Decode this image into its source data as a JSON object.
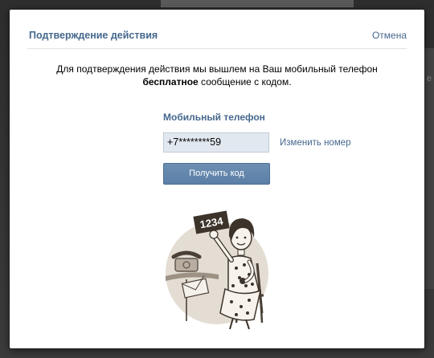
{
  "dialog": {
    "title": "Подтверждение действия",
    "cancel_label": "Отмена",
    "message_line1": "Для подтверждения действия мы вышлем на Ваш мобильный телефон",
    "message_bold": "бесплатное",
    "message_rest": " сообщение с кодом.",
    "phone_label": "Мобильный телефон",
    "phone_value": "+7********59",
    "change_number_label": "Изменить номер",
    "get_code_label": "Получить код",
    "illustration_sign_text": "1234"
  },
  "colors": {
    "link": "#45688e",
    "button": "#5b7fa6",
    "input_bg": "#e2e8ef",
    "backdrop": "#3a3a3a"
  }
}
